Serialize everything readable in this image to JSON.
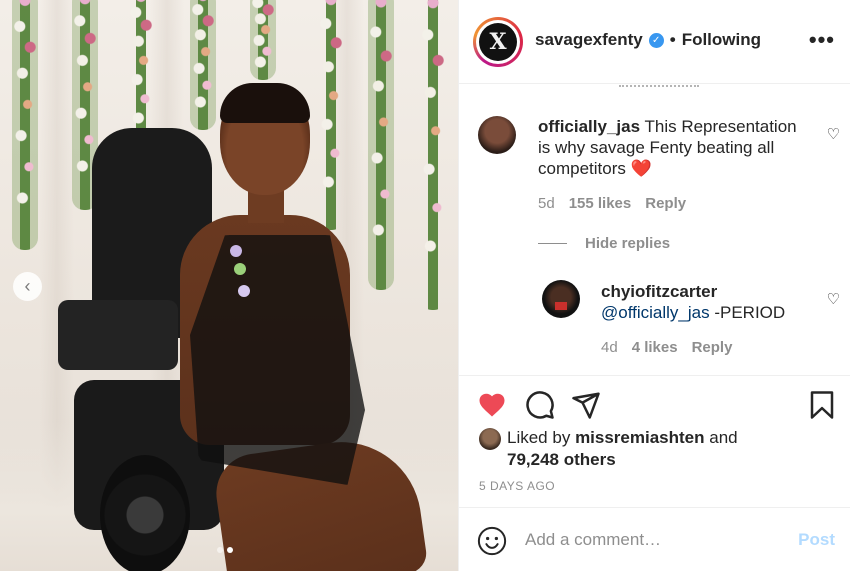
{
  "post": {
    "account": {
      "username": "savagexfenty",
      "verified_icon": "verified-badge-icon",
      "separator": "•",
      "follow_status": "Following",
      "avatar_letter": "X"
    },
    "more_icon": "more-options-icon",
    "more_label": "•••",
    "carousel": {
      "prev_icon": "chevron-left-icon",
      "prev_label": "‹",
      "slide_count": 2,
      "active_slide": 2
    }
  },
  "comments": [
    {
      "username": "officially_jas",
      "text": "This Representation is why savage Fenty beating all competitors",
      "emoji": "❤️",
      "age": "5d",
      "likes": "155 likes",
      "reply_label": "Reply",
      "like_icon": "heart-outline-icon",
      "like_label": "♡"
    },
    {
      "username": "chyiofitzcarter",
      "mention": "@officially_jas",
      "text": "-PERIOD",
      "age": "4d",
      "likes": "4 likes",
      "reply_label": "Reply",
      "like_icon": "heart-outline-icon",
      "like_label": "♡"
    }
  ],
  "hide_replies_label": "Hide replies",
  "actions": {
    "like_icon": "heart-filled-icon",
    "comment_icon": "comment-icon",
    "share_icon": "share-icon",
    "save_icon": "bookmark-icon",
    "like_color": "#ed4956"
  },
  "likes_summary": {
    "prefix": "Liked by",
    "user": "missremiashten",
    "suffix": "and",
    "others": "79,248 others"
  },
  "timestamp": "5 DAYS AGO",
  "add_comment": {
    "emoji_icon": "smiley-icon",
    "placeholder": "Add a comment…",
    "post_label": "Post",
    "post_color": "#b3dbff"
  },
  "colors": {
    "text": "#262626",
    "muted": "#8e8e8e",
    "link": "#00376b",
    "verified": "#3897f0"
  }
}
